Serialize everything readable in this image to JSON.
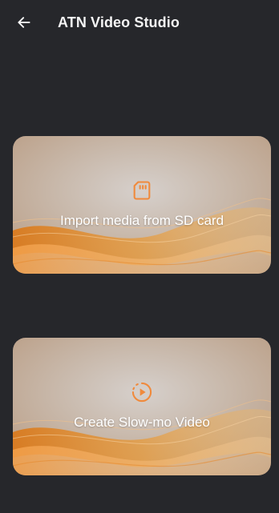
{
  "app_bar": {
    "title": "ATN Video Studio",
    "back_icon": "arrow-left-icon"
  },
  "cards": [
    {
      "label": "Import media from SD card",
      "icon": "sd-card-icon"
    },
    {
      "label": "Create Slow-mo Video",
      "icon": "slow-motion-icon"
    }
  ],
  "colors": {
    "background": "#26272b",
    "accent": "#f08a3c",
    "card_base": "#c9b3a0"
  }
}
